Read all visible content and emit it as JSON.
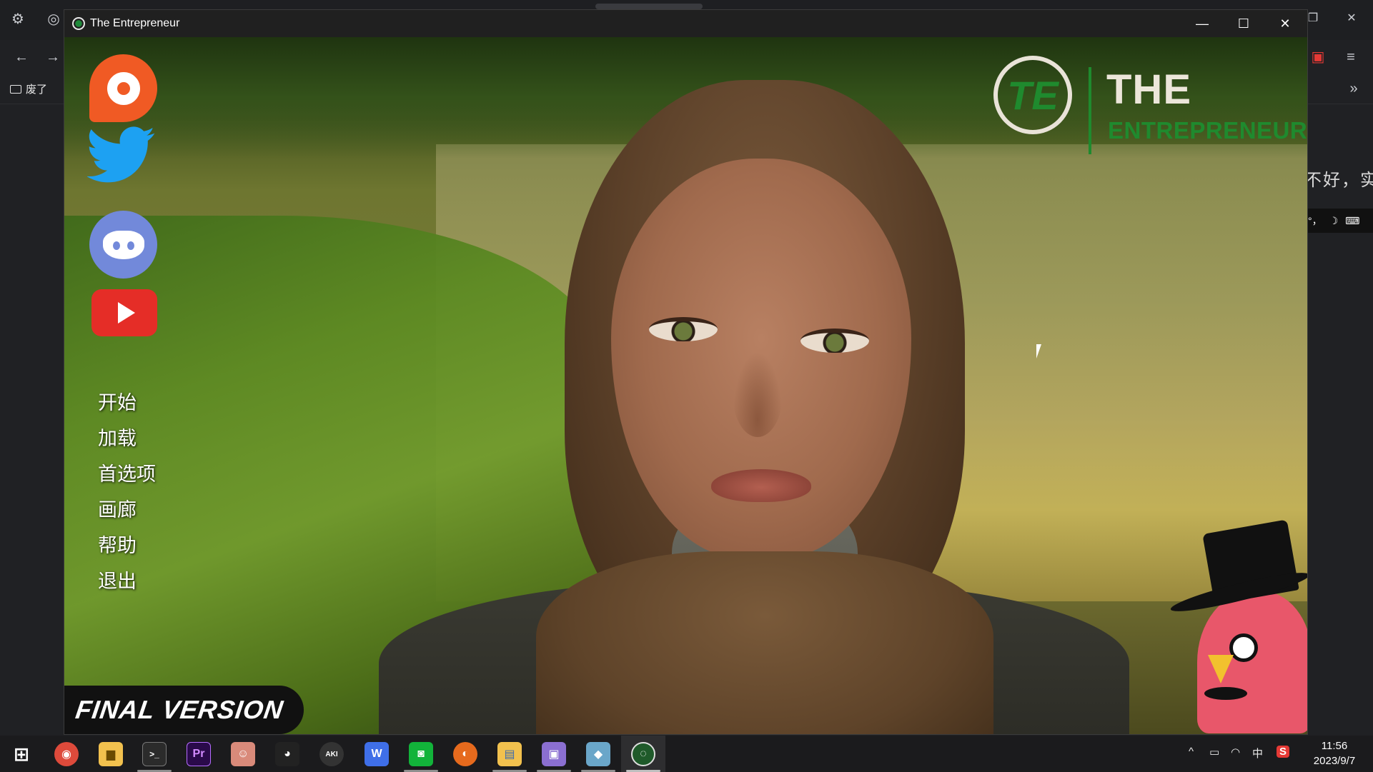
{
  "browser": {
    "bookmark_label": "废了",
    "side_text": "不好，实",
    "ime": {
      "brand": "S",
      "mode": "中",
      "punct": "°，",
      "moon": "☽",
      "keyboard": "⌨"
    }
  },
  "window": {
    "title": "The Entrepreneur",
    "controls": {
      "minimize": "—",
      "maximize": "☐",
      "close": "✕"
    }
  },
  "game": {
    "logo": {
      "emblem": "TE",
      "line1": "THE",
      "line2": "ENTREPRENEUR"
    },
    "menu": [
      "开始",
      "加载",
      "首选项",
      "画廊",
      "帮助",
      "退出"
    ],
    "badge": "FINAL VERSION",
    "social": [
      "patreon-icon",
      "twitter-icon",
      "discord-icon",
      "youtube-icon"
    ]
  },
  "taskbar": {
    "apps": [
      {
        "name": "start",
        "glyph": "⊞",
        "color": "#1b1b1d"
      },
      {
        "name": "chrome",
        "glyph": "◉",
        "color": "#de4a3b"
      },
      {
        "name": "folder",
        "glyph": "▆",
        "color": "#f2c14e"
      },
      {
        "name": "terminal",
        "glyph": ">_",
        "color": "#2b2b2b"
      },
      {
        "name": "premiere",
        "glyph": "Pr",
        "color": "#2a0a4a"
      },
      {
        "name": "anime-app",
        "glyph": "☺",
        "color": "#d98a7a"
      },
      {
        "name": "qq",
        "glyph": "◕",
        "color": "#222"
      },
      {
        "name": "aki",
        "glyph": "AKI",
        "color": "#333"
      },
      {
        "name": "w-app",
        "glyph": "W",
        "color": "#3f6fe8"
      },
      {
        "name": "wechat-app",
        "glyph": "◙",
        "color": "#12b33a"
      },
      {
        "name": "firefox",
        "glyph": "◐",
        "color": "#e66a1d"
      },
      {
        "name": "explorer",
        "glyph": "▤",
        "color": "#f2c14e"
      },
      {
        "name": "purple-app",
        "glyph": "▣",
        "color": "#8b6fd1"
      },
      {
        "name": "blue-app",
        "glyph": "◆",
        "color": "#6aa6c9"
      },
      {
        "name": "game-app",
        "glyph": "◌",
        "color": "#1f5a2a"
      }
    ],
    "tray": {
      "chevron": "^",
      "battery": "▭",
      "wifi": "◠",
      "ime": "中",
      "sogou": "S"
    },
    "clock": {
      "time": "11:56",
      "date": "2023/9/7"
    }
  }
}
